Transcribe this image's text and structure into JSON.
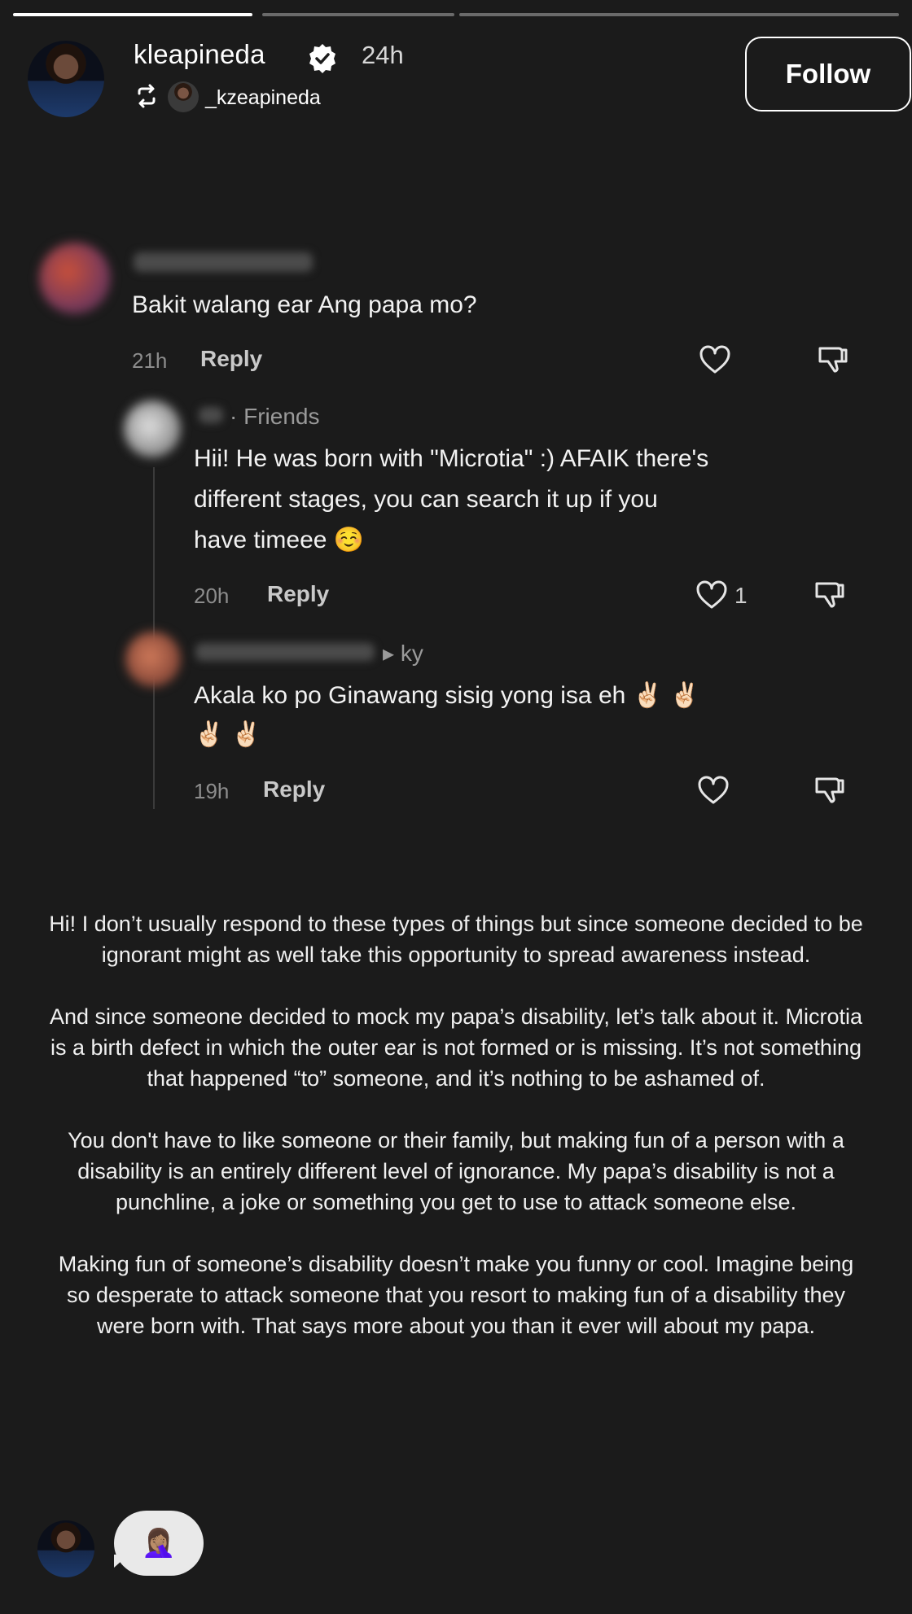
{
  "story": {
    "progress": [
      1,
      0
    ]
  },
  "header": {
    "username": "kleapineda",
    "time": "24h",
    "reposted_by": "_kzeapineda",
    "follow_label": "Follow"
  },
  "comments": [
    {
      "text": "Bakit walang ear Ang papa mo?",
      "time": "21h",
      "reply_label": "Reply"
    },
    {
      "tag": "· Friends",
      "text_lines": [
        "Hii! He was born with \"Microtia\" :) AFAIK there's",
        "different stages, you can search it up if you",
        "have timeee ☺️"
      ],
      "time": "20h",
      "reply_label": "Reply",
      "likes": "1"
    },
    {
      "tag": "▸ ky",
      "text_lines": [
        "Akala ko po Ginawang sisig yong isa eh ✌🏻 ✌🏻",
        "✌🏻 ✌🏻"
      ],
      "time": "19h",
      "reply_label": "Reply"
    }
  ],
  "caption": {
    "paragraphs": [
      "Hi! I don’t usually respond to these types of things but since someone decided to be ignorant might as well take this opportunity to spread awareness instead.",
      "And since someone decided to mock my papa’s disability, let’s talk about it. Microtia is a birth defect in which the outer ear is not formed or is missing. It’s not something that happened “to” someone, and it’s nothing to be ashamed of.",
      "You don't have to like someone or their family, but making fun of a person with a disability is an entirely different level of ignorance. My papa’s disability is not a punchline, a joke or something you get to use to attack someone else.",
      "Making fun of someone’s disability doesn’t make you funny or cool. Imagine being so desperate to attack someone that you resort to making fun of a disability they were born with. That says more about you than it ever will about my papa."
    ]
  },
  "footer": {
    "reaction_emoji": "🤦🏽‍♀️"
  }
}
